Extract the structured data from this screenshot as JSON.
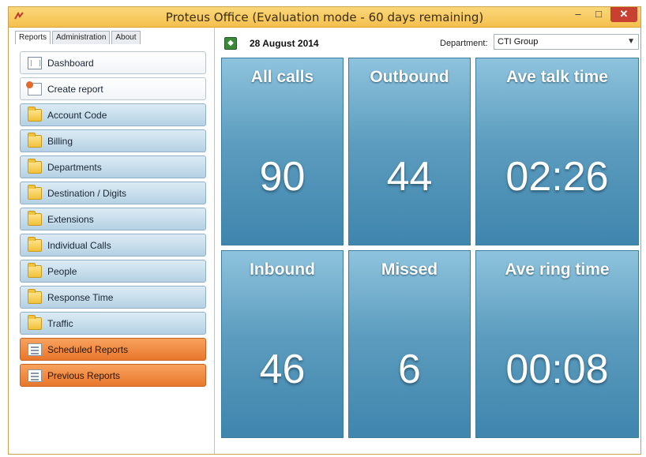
{
  "window": {
    "title": "Proteus Office (Evaluation mode - 60 days remaining)"
  },
  "tabs": [
    "Reports",
    "Administration",
    "About"
  ],
  "nav": [
    {
      "label": "Dashboard",
      "style": "white",
      "icon": "dashboard-icon"
    },
    {
      "label": "Create report",
      "style": "white",
      "icon": "create-report-icon"
    },
    {
      "label": "Account Code",
      "style": "blue",
      "icon": "folder-icon"
    },
    {
      "label": "Billing",
      "style": "blue",
      "icon": "folder-icon"
    },
    {
      "label": "Departments",
      "style": "blue",
      "icon": "folder-icon"
    },
    {
      "label": "Destination / Digits",
      "style": "blue",
      "icon": "folder-icon"
    },
    {
      "label": "Extensions",
      "style": "blue",
      "icon": "folder-icon"
    },
    {
      "label": "Individual Calls",
      "style": "blue",
      "icon": "folder-icon"
    },
    {
      "label": "People",
      "style": "blue",
      "icon": "folder-icon"
    },
    {
      "label": "Response Time",
      "style": "blue",
      "icon": "folder-icon"
    },
    {
      "label": "Traffic",
      "style": "blue",
      "icon": "folder-icon"
    },
    {
      "label": "Scheduled Reports",
      "style": "orange",
      "icon": "scheduled-reports-icon"
    },
    {
      "label": "Previous Reports",
      "style": "orange",
      "icon": "previous-reports-icon"
    }
  ],
  "toolbar": {
    "date": "28 August 2014",
    "department_label": "Department:",
    "department_value": "CTI Group"
  },
  "tiles": [
    {
      "label": "All calls",
      "value": "90"
    },
    {
      "label": "Outbound",
      "value": "44"
    },
    {
      "label": "Ave talk time",
      "value": "02:26"
    },
    {
      "label": "Inbound",
      "value": "46"
    },
    {
      "label": "Missed",
      "value": "6"
    },
    {
      "label": "Ave ring time",
      "value": "00:08"
    }
  ],
  "colors": {
    "titlebar": "#f4c04d",
    "tile": "#5d9dbf",
    "orange_button": "#e8772b",
    "close_button": "#c8402f"
  }
}
